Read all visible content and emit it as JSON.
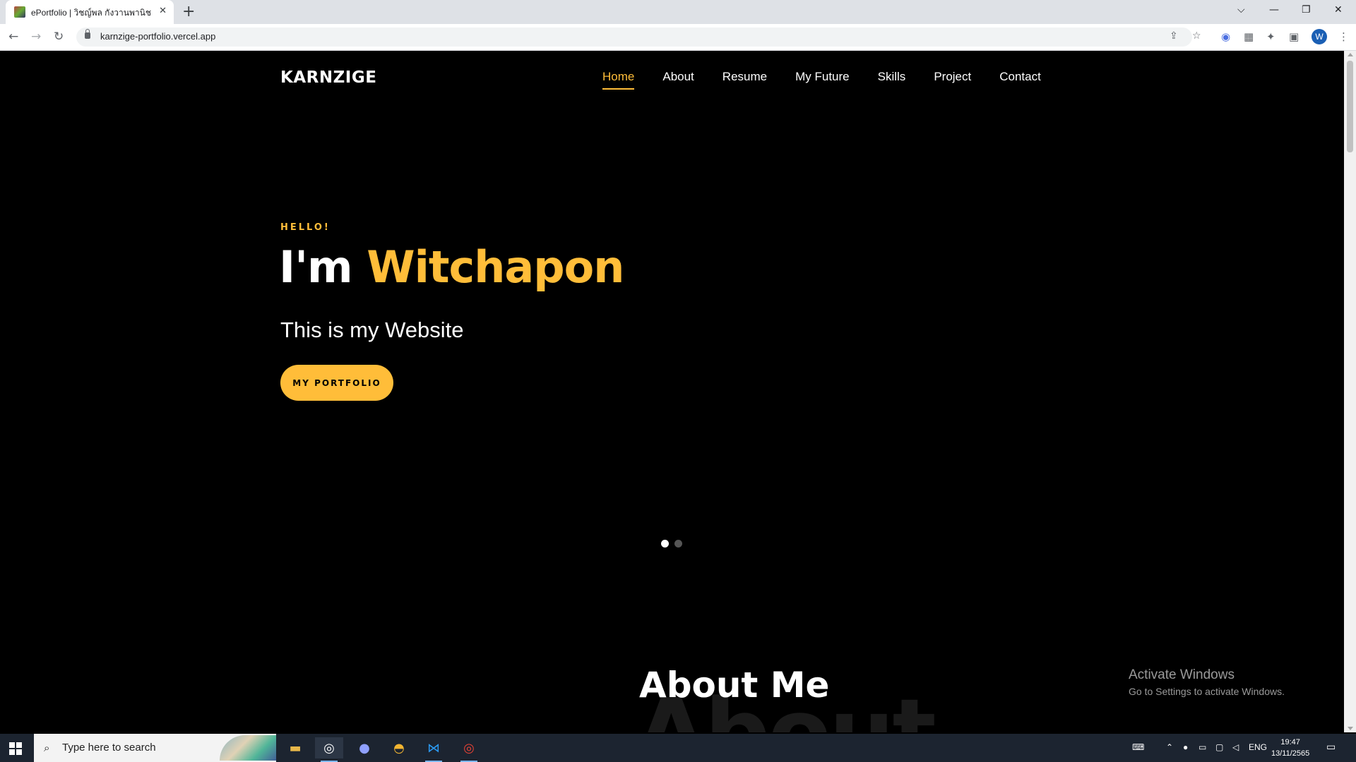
{
  "browser": {
    "tab_title": "ePortfolio | วิชญ์พล กังวานพานิชย์",
    "url": "karnzige-portfolio.vercel.app",
    "new_tab_icon": "+",
    "close_tab_icon": "✕",
    "window_controls": [
      "⌵",
      "—",
      "❐",
      "✕"
    ],
    "profile_initial": "W"
  },
  "site": {
    "logo": "KARNZIGE",
    "nav": [
      "Home",
      "About",
      "Resume",
      "My Future",
      "Skills",
      "Project",
      "Contact"
    ],
    "active_nav": "Home",
    "accent_color": "#ffbd39",
    "hero": {
      "greeting": "HELLO!",
      "headline_prefix": "I'm ",
      "headline_name": "Witchapon",
      "subtitle": "This is my Website",
      "cta_label": "MY PORTFOLIO"
    },
    "carousel": {
      "slide_count": 2,
      "active_slide": 1
    },
    "about": {
      "title": "About Me",
      "background_word": "About"
    }
  },
  "os": {
    "activation_title": "Activate Windows",
    "activation_subtitle": "Go to Settings to activate Windows.",
    "search_placeholder": "Type here to search",
    "language": "ENG",
    "time": "19:47",
    "date": "13/11/2565"
  }
}
